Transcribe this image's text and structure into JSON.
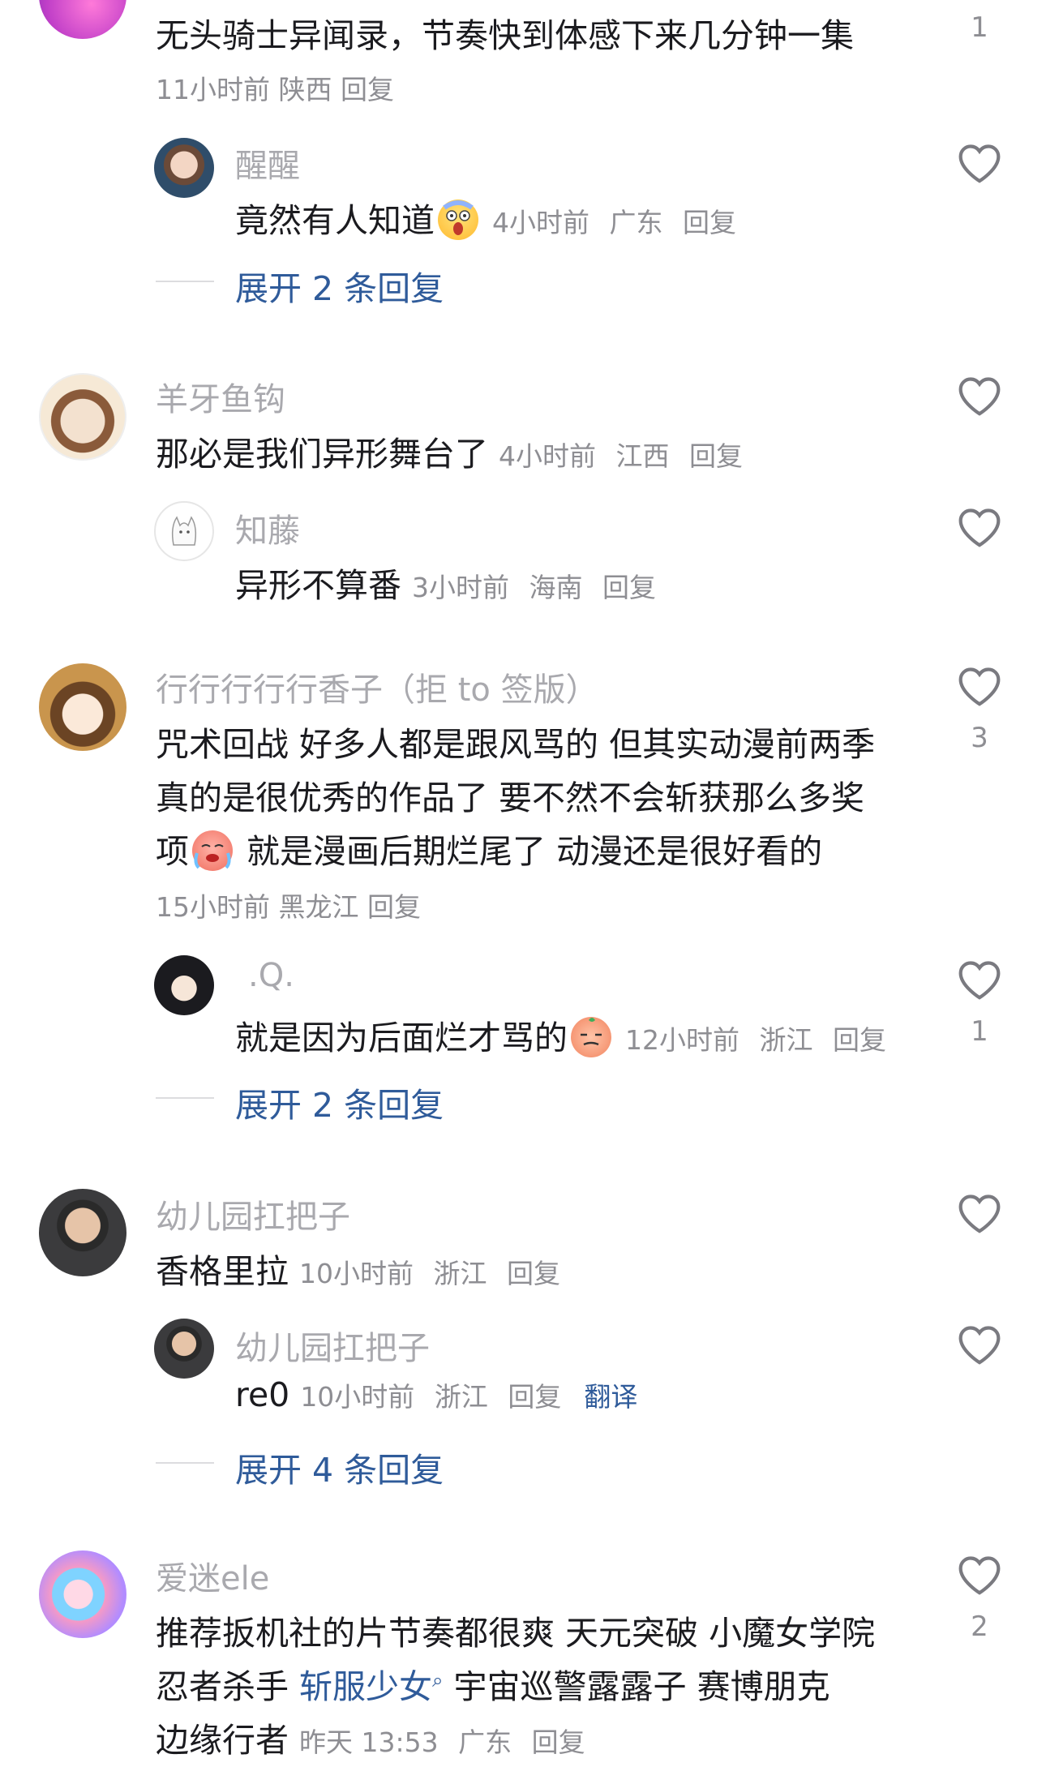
{
  "comments": [
    {
      "body": "无头骑士异闻录，节奏快到体感下来几分钟一集",
      "time": "11小时前",
      "region": "陕西",
      "reply": "回复",
      "likes": "1",
      "replies": [
        {
          "user": "醒醒",
          "body": "竟然有人知道",
          "time": "4小时前",
          "region": "广东",
          "reply": "回复"
        }
      ],
      "expand": "展开 2 条回复"
    },
    {
      "user": "羊牙鱼钩",
      "body": "那必是我们异形舞台了",
      "time": "4小时前",
      "region": "江西",
      "reply": "回复",
      "replies": [
        {
          "user": "知藤",
          "body": "异形不算番",
          "time": "3小时前",
          "region": "海南",
          "reply": "回复"
        }
      ]
    },
    {
      "user": "行行行行行香子（拒 to 签版）",
      "lines": [
        "咒术回战 好多人都是跟风骂的 但其实动漫前两季",
        "真的是很优秀的作品了 要不然不会斩获那么多奖",
        "项",
        "就是漫画后期烂尾了 动漫还是很好看的"
      ],
      "time": "15小时前",
      "region": "黑龙江",
      "reply": "回复",
      "likes": "3",
      "replies": [
        {
          "user": ".Q.",
          "body": "就是因为后面烂才骂的",
          "time": "12小时前",
          "region": "浙江",
          "reply": "回复",
          "likes": "1"
        }
      ],
      "expand": "展开 2 条回复"
    },
    {
      "user": "幼儿园扛把子",
      "body": "香格里拉",
      "time": "10小时前",
      "region": "浙江",
      "reply": "回复",
      "replies": [
        {
          "user": "幼儿园扛把子",
          "body": "re0",
          "time": "10小时前",
          "region": "浙江",
          "reply": "回复",
          "translate": "翻译"
        }
      ],
      "expand": "展开 4 条回复"
    },
    {
      "user": "爱迷ele",
      "lines": [
        "推荐扳机社的片节奏都很爽 天元突破 小魔女学院",
        "忍者杀手",
        "斩服少女",
        "宇宙巡警露露子 赛博朋克",
        "边缘行者"
      ],
      "time": "昨天 13:53",
      "region": "广东",
      "reply": "回复",
      "likes": "2"
    }
  ],
  "colors": {
    "link": "#2f5b9a",
    "meta": "#8e8e93",
    "username": "#a9a9ae",
    "text": "#1b1b1f"
  }
}
